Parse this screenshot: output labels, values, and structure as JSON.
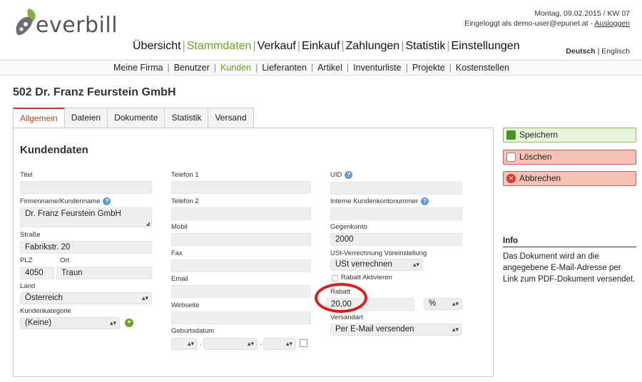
{
  "logo": {
    "text": "everbill"
  },
  "topbar": {
    "date_line": "Montag, 09.02.2015 / KW 07",
    "login_text": "Eingeloggt als demo-user@epunet.at - ",
    "logout_label": "Ausloggen"
  },
  "mainnav": {
    "items": [
      "Übersicht",
      "Stammdaten",
      "Verkauf",
      "Einkauf",
      "Zahlungen",
      "Statistik",
      "Einstellungen"
    ],
    "active": "Stammdaten"
  },
  "lang": {
    "de": "Deutsch",
    "sep": " | ",
    "en": "Englisch"
  },
  "subnav": {
    "items": [
      "Meine Firma",
      "Benutzer",
      "Kunden",
      "Lieferanten",
      "Artikel",
      "Inventurliste",
      "Projekte",
      "Kostenstellen"
    ],
    "active": "Kunden"
  },
  "page": {
    "title": "502 Dr. Franz Feurstein GmbH"
  },
  "tabs": [
    "Allgemein",
    "Dateien",
    "Dokumente",
    "Statistik",
    "Versand"
  ],
  "form": {
    "heading": "Kundendaten",
    "titel": {
      "label": "Titel",
      "value": ""
    },
    "firmenname": {
      "label": "Firmenname/Kundenname",
      "value": "Dr. Franz Feurstein GmbH"
    },
    "strasse": {
      "label": "Straße",
      "value": "Fabrikstr. 20"
    },
    "plz": {
      "label": "PLZ",
      "value": "4050"
    },
    "ort": {
      "label": "Ort",
      "value": "Traun"
    },
    "land": {
      "label": "Land",
      "value": "Österreich"
    },
    "kundenkategorie": {
      "label": "Kundenkategorie",
      "value": "(Keine)"
    },
    "telefon1": {
      "label": "Telefon 1",
      "value": ""
    },
    "telefon2": {
      "label": "Telefon 2",
      "value": ""
    },
    "mobil": {
      "label": "Mobil",
      "value": ""
    },
    "fax": {
      "label": "Fax",
      "value": ""
    },
    "email": {
      "label": "Email",
      "value": ""
    },
    "webseite": {
      "label": "Webseite",
      "value": ""
    },
    "geburtsdatum": {
      "label": "Geburtsdatum",
      "sep": "."
    },
    "uid": {
      "label": "UID",
      "value": ""
    },
    "kundenkonto": {
      "label": "Interne Kundenkontonummer",
      "value": ""
    },
    "gegenkonto": {
      "label": "Gegenkonto",
      "value": "2000"
    },
    "ust": {
      "label": "USt-Verrechnung Voreinstellung",
      "value": "USt verrechnen"
    },
    "rabatt_aktiv": {
      "label": "Rabatt Aktivieren"
    },
    "rabatt": {
      "label": "Rabatt",
      "value": "20,00",
      "unit": "%"
    },
    "versandart": {
      "label": "Versandart",
      "value": "Per E-Mail versenden"
    }
  },
  "actions": {
    "save": "Speichern",
    "delete": "Löschen",
    "cancel": "Abbrechen"
  },
  "info": {
    "title": "Info",
    "text": "Das Dokument wird an die angegebene E-Mail-Adresse per Link zum PDF-Dokument versendet."
  },
  "colors": {
    "accent": "#6aa121",
    "tab_active": "#b5451b",
    "highlight_circle": "#d91e1e"
  }
}
